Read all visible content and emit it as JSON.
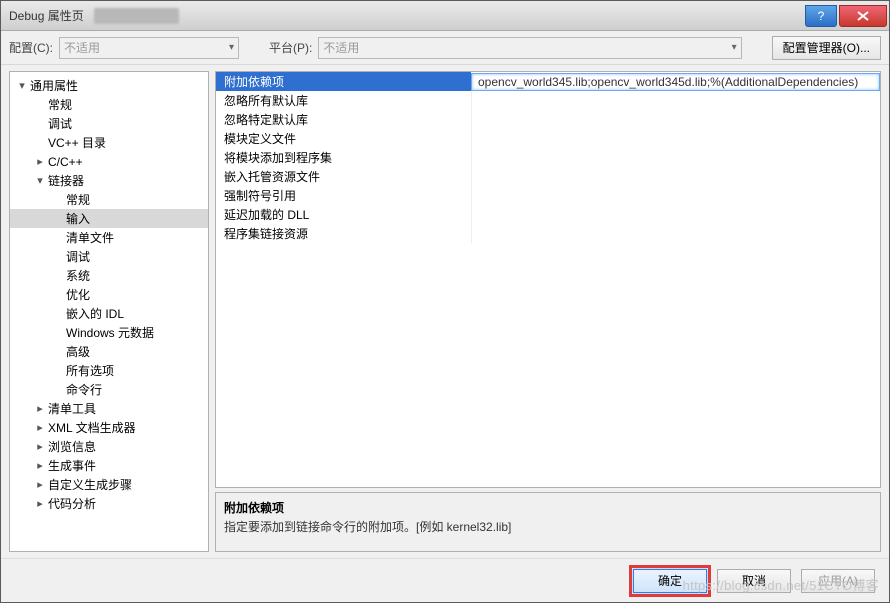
{
  "window": {
    "title": "Debug 属性页"
  },
  "toolbar": {
    "config_label": "配置(C):",
    "config_value": "不适用",
    "platform_label": "平台(P):",
    "platform_value": "不适用",
    "config_manager": "配置管理器(O)..."
  },
  "tree": [
    {
      "label": "通用属性",
      "depth": 0,
      "exp": "▾"
    },
    {
      "label": "常规",
      "depth": 1,
      "exp": ""
    },
    {
      "label": "调试",
      "depth": 1,
      "exp": ""
    },
    {
      "label": "VC++ 目录",
      "depth": 1,
      "exp": ""
    },
    {
      "label": "C/C++",
      "depth": 1,
      "exp": "▸"
    },
    {
      "label": "链接器",
      "depth": 1,
      "exp": "▾"
    },
    {
      "label": "常规",
      "depth": 2,
      "exp": ""
    },
    {
      "label": "输入",
      "depth": 2,
      "exp": "",
      "sel": true
    },
    {
      "label": "清单文件",
      "depth": 2,
      "exp": ""
    },
    {
      "label": "调试",
      "depth": 2,
      "exp": ""
    },
    {
      "label": "系统",
      "depth": 2,
      "exp": ""
    },
    {
      "label": "优化",
      "depth": 2,
      "exp": ""
    },
    {
      "label": "嵌入的 IDL",
      "depth": 2,
      "exp": ""
    },
    {
      "label": "Windows 元数据",
      "depth": 2,
      "exp": ""
    },
    {
      "label": "高级",
      "depth": 2,
      "exp": ""
    },
    {
      "label": "所有选项",
      "depth": 2,
      "exp": ""
    },
    {
      "label": "命令行",
      "depth": 2,
      "exp": ""
    },
    {
      "label": "清单工具",
      "depth": 1,
      "exp": "▸"
    },
    {
      "label": "XML 文档生成器",
      "depth": 1,
      "exp": "▸"
    },
    {
      "label": "浏览信息",
      "depth": 1,
      "exp": "▸"
    },
    {
      "label": "生成事件",
      "depth": 1,
      "exp": "▸"
    },
    {
      "label": "自定义生成步骤",
      "depth": 1,
      "exp": "▸"
    },
    {
      "label": "代码分析",
      "depth": 1,
      "exp": "▸"
    }
  ],
  "grid": [
    {
      "name": "附加依赖项",
      "value": "opencv_world345.lib;opencv_world345d.lib;%(AdditionalDependencies)",
      "sel": true
    },
    {
      "name": "忽略所有默认库",
      "value": ""
    },
    {
      "name": "忽略特定默认库",
      "value": ""
    },
    {
      "name": "模块定义文件",
      "value": ""
    },
    {
      "name": "将模块添加到程序集",
      "value": ""
    },
    {
      "name": "嵌入托管资源文件",
      "value": ""
    },
    {
      "name": "强制符号引用",
      "value": ""
    },
    {
      "name": "延迟加载的 DLL",
      "value": ""
    },
    {
      "name": "程序集链接资源",
      "value": ""
    }
  ],
  "desc": {
    "title": "附加依赖项",
    "body": "指定要添加到链接命令行的附加项。[例如 kernel32.lib]"
  },
  "footer": {
    "ok": "确定",
    "cancel": "取消",
    "apply": "应用(A)"
  },
  "watermark": "https://blog.csdn.net/51CTO博客"
}
